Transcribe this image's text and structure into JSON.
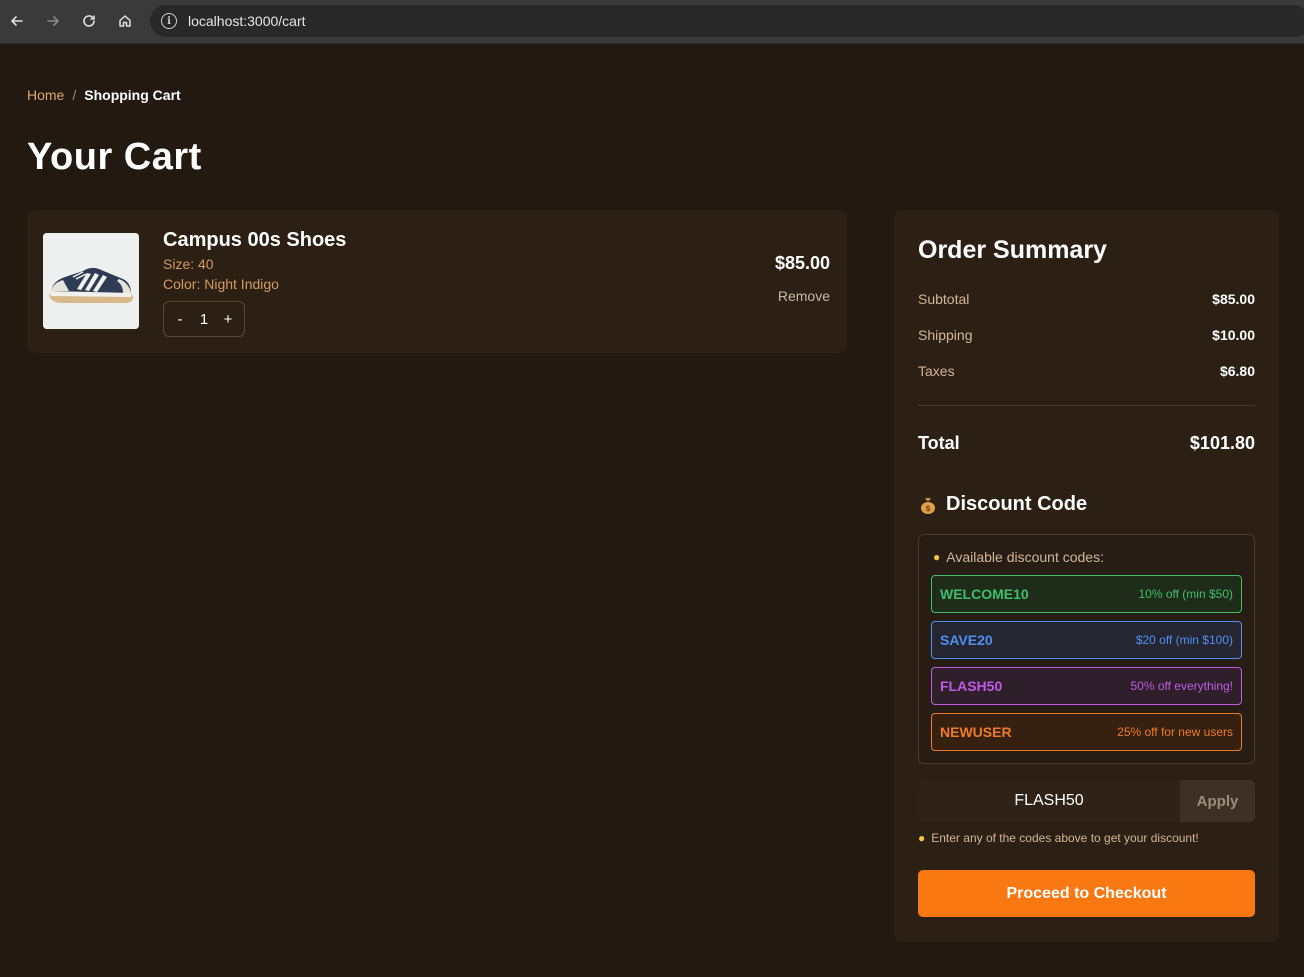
{
  "browser": {
    "url": "localhost:3000/cart",
    "back_icon": "arrow-left-icon",
    "forward_icon": "arrow-right-icon",
    "reload_icon": "reload-icon",
    "home_icon": "home-icon",
    "info_icon": "info-icon"
  },
  "breadcrumb": {
    "home": "Home",
    "separator": "/",
    "current": "Shopping Cart"
  },
  "page_title": "Your Cart",
  "cart": {
    "items": [
      {
        "name": "Campus 00s Shoes",
        "size": "Size: 40",
        "color": "Color: Night Indigo",
        "quantity": "1",
        "price": "$85.00",
        "remove_label": "Remove",
        "decrement_label": "-",
        "increment_label": "+"
      }
    ]
  },
  "summary": {
    "title": "Order Summary",
    "subtotal_label": "Subtotal",
    "subtotal_value": "$85.00",
    "shipping_label": "Shipping",
    "shipping_value": "$10.00",
    "taxes_label": "Taxes",
    "taxes_value": "$6.80",
    "total_label": "Total",
    "total_value": "$101.80"
  },
  "discount": {
    "title": "Discount Code",
    "title_icon": "money-bag-icon",
    "available_label": "Available discount codes:",
    "codes": [
      {
        "code": "WELCOME10",
        "desc": "10% off (min $50)",
        "color": "#3fbf6a",
        "bg": "#1f2c1a"
      },
      {
        "code": "SAVE20",
        "desc": "$20 off (min $100)",
        "color": "#4f8ff0",
        "bg": "#252632"
      },
      {
        "code": "FLASH50",
        "desc": "50% off everything!",
        "color": "#c05ae6",
        "bg": "#2e1f2a"
      },
      {
        "code": "NEWUSER",
        "desc": "25% off for new users",
        "color": "#f07a2a",
        "bg": "#36200f"
      }
    ],
    "input_value": "FLASH50",
    "apply_label": "Apply",
    "hint": "Enter any of the codes above to get your discount!"
  },
  "checkout_label": "Proceed to Checkout",
  "colors": {
    "background": "#221911",
    "card": "#2c2015",
    "accent": "#f97812"
  }
}
